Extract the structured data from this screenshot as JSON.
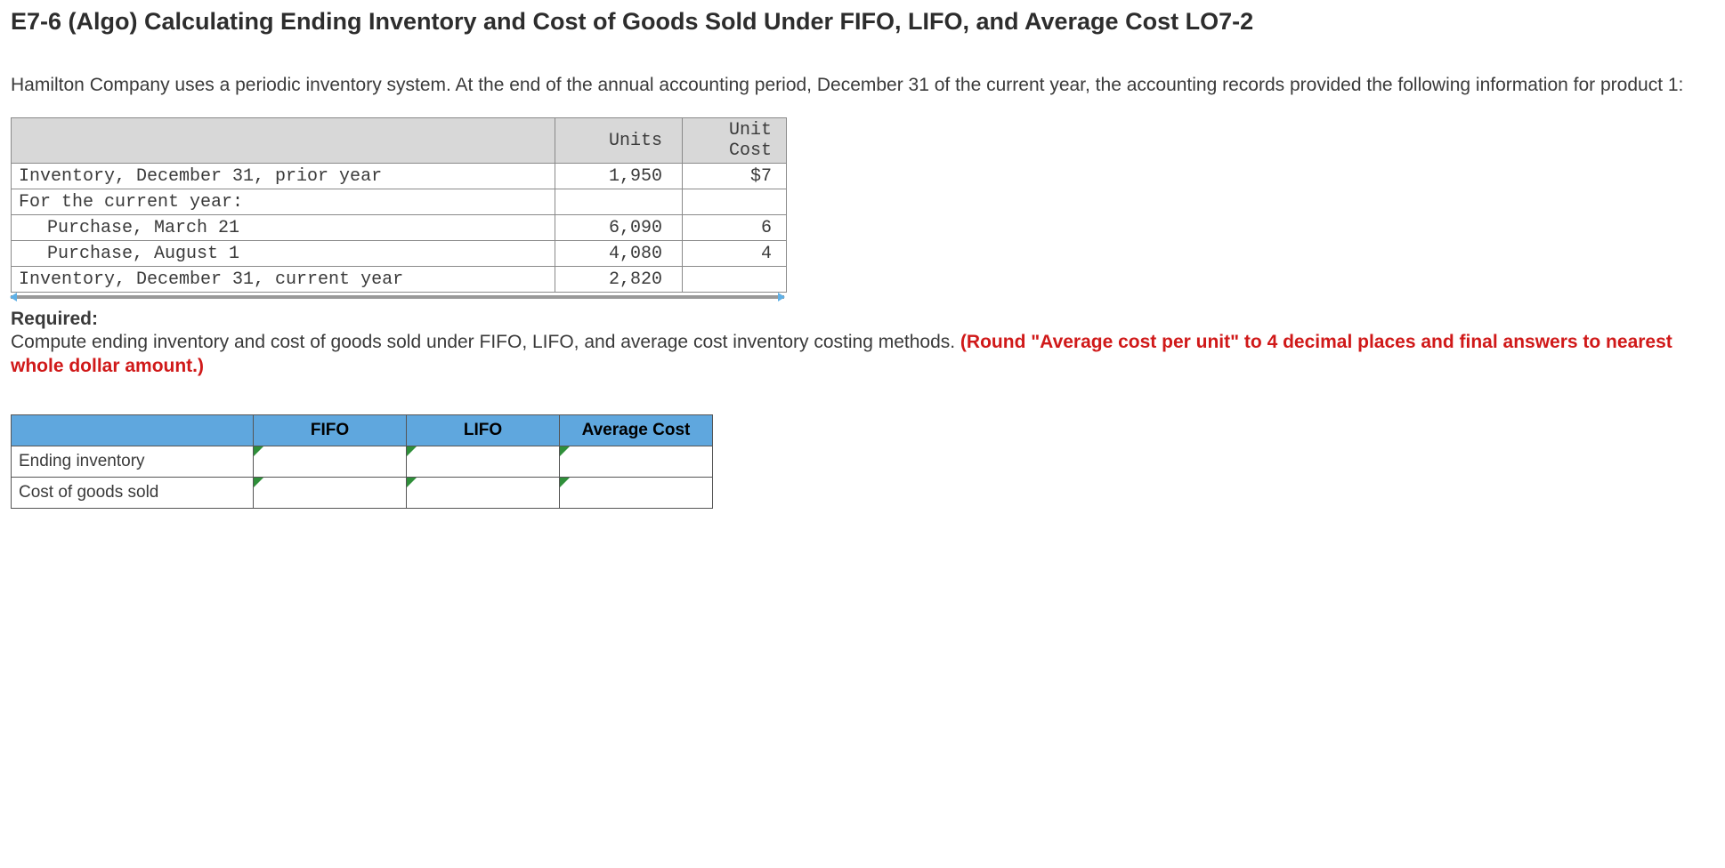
{
  "title": "E7-6 (Algo) Calculating Ending Inventory and Cost of Goods Sold Under FIFO, LIFO, and Average Cost LO7-2",
  "intro": "Hamilton Company uses a periodic inventory system. At the end of the annual accounting period, December 31 of the current year, the accounting records provided the following information for product 1:",
  "inv_table": {
    "headers": {
      "units": "Units",
      "unit_cost": "Unit Cost"
    },
    "rows": [
      {
        "label": "Inventory, December 31, prior year",
        "units": "1,950",
        "cost": "$7",
        "indent": false
      },
      {
        "label": "For the current year:",
        "units": "",
        "cost": "",
        "indent": false
      },
      {
        "label": "Purchase, March 21",
        "units": "6,090",
        "cost": "6",
        "indent": true
      },
      {
        "label": "Purchase, August 1",
        "units": "4,080",
        "cost": "4",
        "indent": true
      },
      {
        "label": "Inventory, December 31, current year",
        "units": "2,820",
        "cost": "",
        "indent": false
      }
    ]
  },
  "required_label": "Required:",
  "required_text_plain": "Compute ending inventory and cost of goods sold under FIFO, LIFO, and average cost inventory costing methods. ",
  "required_text_red": "(Round \"Average cost per unit\" to 4 decimal places and final answers to nearest whole dollar amount.)",
  "answer_table": {
    "col_headers": [
      "FIFO",
      "LIFO",
      "Average Cost"
    ],
    "row_labels": [
      "Ending inventory",
      "Cost of goods sold"
    ],
    "values": [
      [
        "",
        "",
        ""
      ],
      [
        "",
        "",
        ""
      ]
    ]
  }
}
